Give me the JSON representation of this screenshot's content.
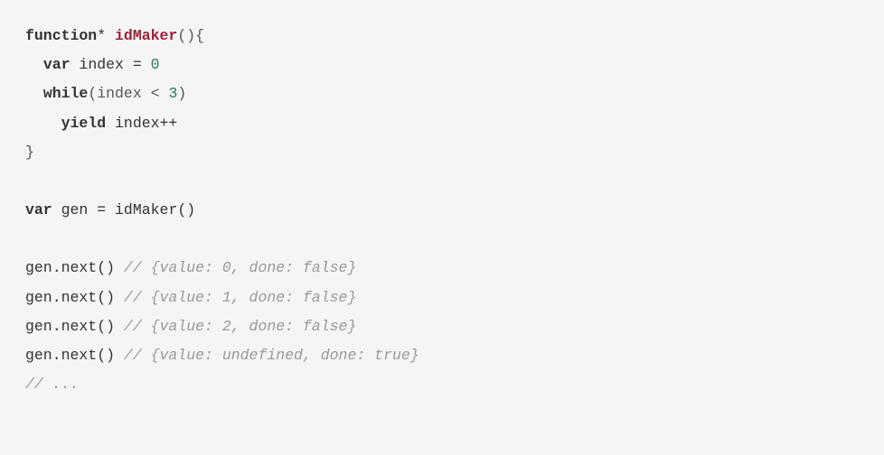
{
  "code": {
    "line1_function": "function",
    "line1_star": "* ",
    "line1_name": "idMaker",
    "line1_parens": "(){",
    "line2_indent": "  ",
    "line2_var": "var",
    "line2_rest": " index = ",
    "line2_num": "0",
    "line3_indent": "  ",
    "line3_while": "while",
    "line3_open": "(index < ",
    "line3_num": "3",
    "line3_close": ")",
    "line4_indent": "    ",
    "line4_yield": "yield",
    "line4_rest": " index++",
    "line5": "}",
    "line6": "",
    "line7_var": "var",
    "line7_rest": " gen = idMaker()",
    "line8": "",
    "line9_call": "gen.next() ",
    "line9_comment": "// {value: 0, done: false}",
    "line10_call": "gen.next() ",
    "line10_comment": "// {value: 1, done: false}",
    "line11_call": "gen.next() ",
    "line11_comment": "// {value: 2, done: false}",
    "line12_call": "gen.next() ",
    "line12_comment": "// {value: undefined, done: true}",
    "line13_comment": "// ..."
  }
}
